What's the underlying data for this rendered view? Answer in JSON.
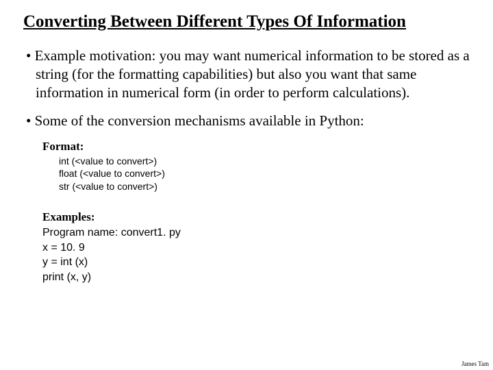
{
  "title": "Converting Between Different Types Of Information",
  "bullets": {
    "b1": "Example motivation: you may want numerical information to be stored as a string (for the formatting capabilities) but also you want that same information in numerical form (in order to perform calculations).",
    "b2": "Some of the conversion mechanisms available in Python:"
  },
  "format": {
    "label": "Format:",
    "line1": "int (<value to convert>)",
    "line2": "float (<value to convert>)",
    "line3": "str (<value to convert>)"
  },
  "examples": {
    "label": "Examples:",
    "line1": "Program name: convert1. py",
    "line2": "x = 10. 9",
    "line3": "y = int (x)",
    "line4": "print (x, y)"
  },
  "footer": "James Tam"
}
